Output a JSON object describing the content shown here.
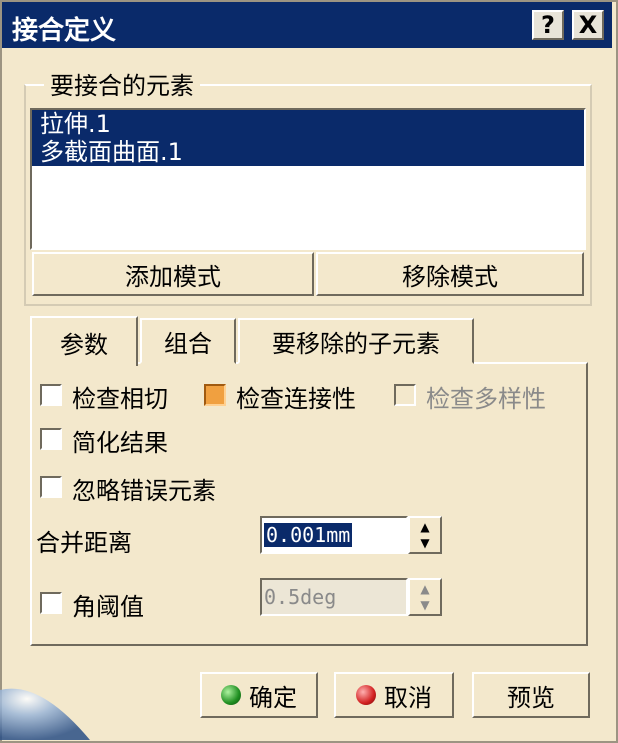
{
  "window": {
    "title": "接合定义",
    "help_label": "?",
    "close_label": "X"
  },
  "elements_group": {
    "legend": "要接合的元素",
    "items": [
      "拉伸.1",
      "多截面曲面.1"
    ],
    "add_mode_label": "添加模式",
    "remove_mode_label": "移除模式"
  },
  "tabs": [
    {
      "label": "参数",
      "active": true
    },
    {
      "label": "组合",
      "active": false
    },
    {
      "label": "要移除的子元素",
      "active": false
    }
  ],
  "params": {
    "check_tangency": {
      "label": "检查相切",
      "checked": false
    },
    "check_connectivity": {
      "label": "检查连接性",
      "checked": true
    },
    "check_manifold": {
      "label": "检查多样性",
      "checked": false,
      "disabled": true
    },
    "simplify_result": {
      "label": "简化结果",
      "checked": false
    },
    "ignore_erroneous": {
      "label": "忽略错误元素",
      "checked": false
    },
    "merge_distance": {
      "label": "合并距离",
      "value": "0.001mm"
    },
    "angular_threshold": {
      "label": "角阈值",
      "checked": false,
      "value": "0.5deg",
      "disabled": true
    }
  },
  "footer": {
    "ok_label": "确定",
    "cancel_label": "取消",
    "preview_label": "预览"
  },
  "colors": {
    "title_bar": "#0a2a6a",
    "dialog_bg": "#f3e8cc",
    "selection": "#0a2a6a",
    "checked_box": "#f0a040"
  }
}
